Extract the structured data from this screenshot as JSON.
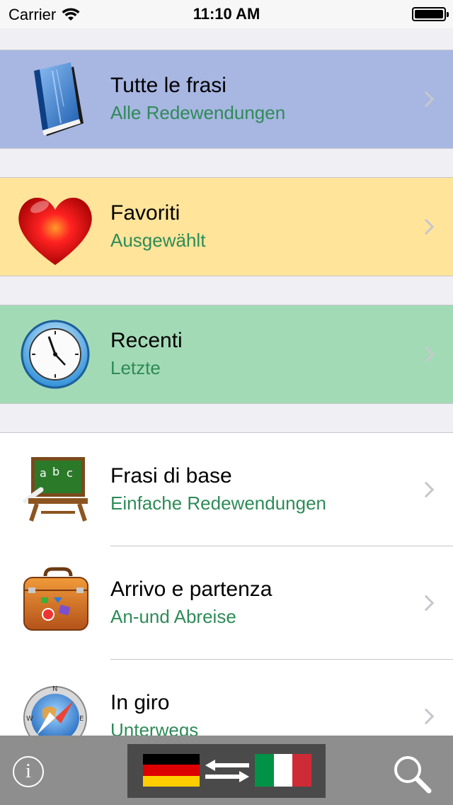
{
  "status": {
    "carrier": "Carrier",
    "time": "11:10 AM"
  },
  "featured": [
    {
      "title": "Tutte le frasi",
      "subtitle": "Alle Redewendungen",
      "icon": "book-icon",
      "color": "#a8b6e2"
    },
    {
      "title": "Favoriti",
      "subtitle": "Ausgewählt",
      "icon": "heart-icon",
      "color": "#ffe49a"
    },
    {
      "title": "Recenti",
      "subtitle": "Letzte",
      "icon": "clock-icon",
      "color": "#a3dab6"
    }
  ],
  "categories": [
    {
      "title": "Frasi di base",
      "subtitle": "Einfache Redewendungen",
      "icon": "blackboard-icon"
    },
    {
      "title": "Arrivo e partenza",
      "subtitle": "An-und Abreise",
      "icon": "suitcase-icon"
    },
    {
      "title": "In giro",
      "subtitle": "Unterwegs",
      "icon": "compass-icon"
    }
  ],
  "toolbar": {
    "info_label": "i",
    "source_language": "German",
    "target_language": "Italian"
  }
}
